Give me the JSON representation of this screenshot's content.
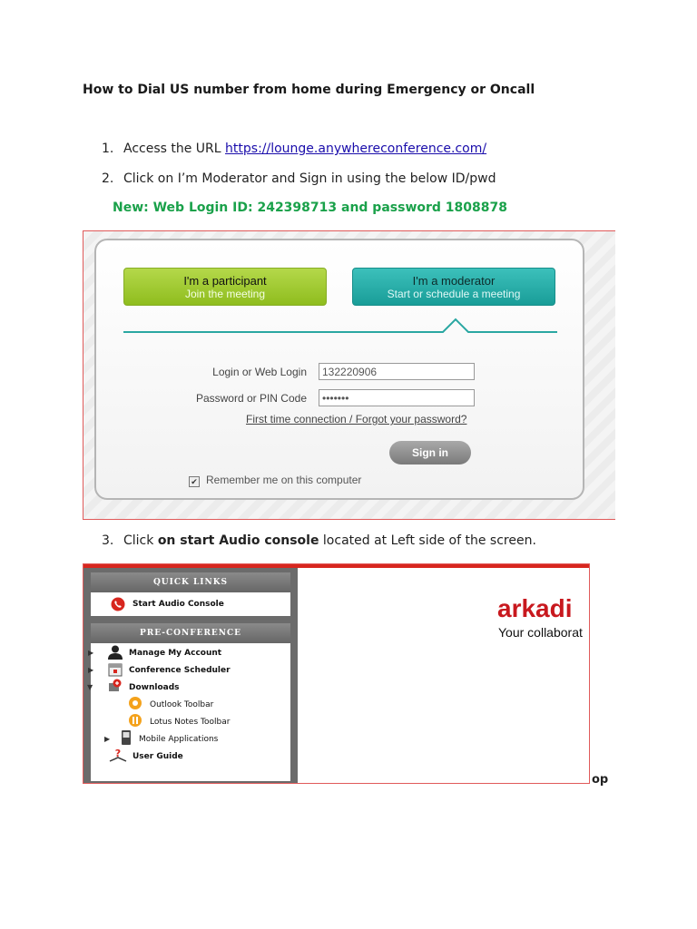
{
  "doc": {
    "title": "How to Dial US number from home during Emergency or Oncall",
    "steps": [
      {
        "num": "1.",
        "text": "Access the URL ",
        "link": "https://lounge.anywhereconference.com/"
      },
      {
        "num": "2.",
        "text": "Click on I’m Moderator and Sign in using the below ID/pwd"
      },
      {
        "num": "3.",
        "pre": "Click ",
        "bold": "on start Audio console",
        "post": " located at Left side of the screen."
      }
    ],
    "new_login": "New: Web Login ID:  242398713 and password 1808878",
    "trailing_fragment": "op"
  },
  "login_screen": {
    "participant_title": "I'm a participant",
    "participant_sub": "Join the meeting",
    "moderator_title": "I'm a moderator",
    "moderator_sub": "Start or schedule a meeting",
    "login_label": "Login or Web Login",
    "login_value": "132220906",
    "password_label": "Password or PIN Code",
    "password_value": "•••••••",
    "forgot_link": "First time connection / Forgot your password?",
    "signin_label": "Sign in",
    "remember_label": "Remember me on this computer",
    "remember_checked": "✔",
    "colors": {
      "participant": "#9cc832",
      "moderator": "#24a9a4",
      "divider": "#2aa7a2"
    }
  },
  "console_screen": {
    "quick_links_header": "QUICK LINKS",
    "start_audio": "Start Audio Console",
    "pre_conference_header": "PRE-CONFERENCE",
    "items": {
      "manage_account": "Manage My Account",
      "scheduler": "Conference Scheduler",
      "downloads": "Downloads",
      "outlook": "Outlook Toolbar",
      "lotus": "Lotus Notes Toolbar",
      "mobile": "Mobile Applications",
      "user_guide": "User Guide"
    },
    "brand": "arkadi",
    "tagline": "Your collaborat",
    "colors": {
      "brand": "#c8181e",
      "sidebar": "#6b6b6b"
    }
  }
}
